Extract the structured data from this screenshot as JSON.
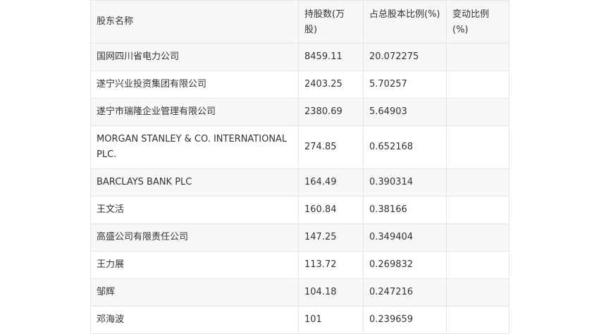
{
  "table": {
    "headers": [
      "股东名称",
      "持股数(万股)",
      "占总股本比例(%)",
      "变动比例(%)"
    ],
    "rows": [
      {
        "name": "国网四川省电力公司",
        "shares": "8459.11",
        "ratio": "20.072275",
        "change": ""
      },
      {
        "name": "遂宁兴业投资集团有限公司",
        "shares": "2403.25",
        "ratio": "5.70257",
        "change": ""
      },
      {
        "name": "遂宁市瑞隆企业管理有限公司",
        "shares": "2380.69",
        "ratio": "5.64903",
        "change": ""
      },
      {
        "name": "MORGAN STANLEY & CO. INTERNATIONAL PLC.",
        "shares": "274.85",
        "ratio": "0.652168",
        "change": ""
      },
      {
        "name": "BARCLAYS BANK PLC",
        "shares": "164.49",
        "ratio": "0.390314",
        "change": ""
      },
      {
        "name": "王文活",
        "shares": "160.84",
        "ratio": "0.38166",
        "change": ""
      },
      {
        "name": "高盛公司有限责任公司",
        "shares": "147.25",
        "ratio": "0.349404",
        "change": ""
      },
      {
        "name": "王力展",
        "shares": "113.72",
        "ratio": "0.269832",
        "change": ""
      },
      {
        "name": "邹辉",
        "shares": "104.18",
        "ratio": "0.247216",
        "change": ""
      },
      {
        "name": "邓海波",
        "shares": "101",
        "ratio": "0.239659",
        "change": ""
      }
    ]
  }
}
